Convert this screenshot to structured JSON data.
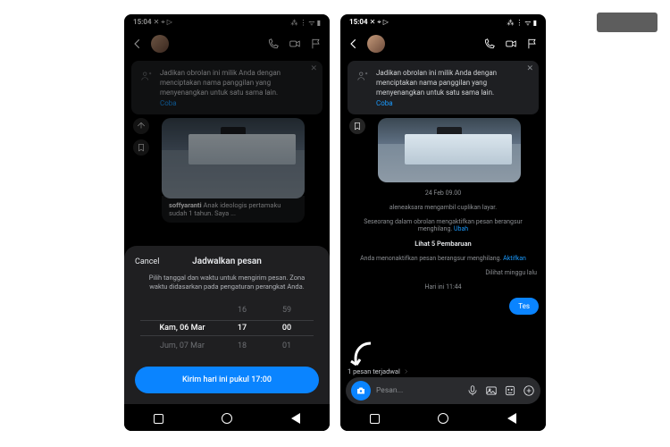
{
  "status": {
    "time": "15:04",
    "left_icons": "✕ ⌖ ▷",
    "right_icons": "⁂ ⋮ ᯤ ▮"
  },
  "header": {
    "call_icon": "call",
    "video_icon": "video",
    "flag_icon": "flag"
  },
  "suggestion": {
    "text": "Jadikan obrolan ini milik Anda dengan menciptakan nama panggilan yang menyenangkan untuk satu sama lain.",
    "try": "Coba"
  },
  "shared": {
    "user": "soffyaranti",
    "caption": "Anak ideologis pertamaku sudah 1 tahun. Saya ..."
  },
  "scheduler": {
    "cancel": "Cancel",
    "title": "Jadwalkan pesan",
    "description": "Pilih tanggal dan waktu untuk mengirim pesan. Zona waktu didasarkan pada pengaturan perangkat Anda.",
    "rows": {
      "prev": {
        "date": "",
        "hour": "16",
        "min": "59"
      },
      "sel": {
        "date": "Kam, 06 Mar",
        "hour": "17",
        "min": "00"
      },
      "next": {
        "date": "Jum, 07 Mar",
        "hour": "18",
        "min": "01"
      }
    },
    "send": "Kirim hari ini pukul 17:00"
  },
  "timeline": {
    "ts1": "24 Feb 09.00",
    "l1": "aleneaksara mengambil cuplikan layar.",
    "l2a": "Seseorang dalam obrolan mengaktifkan pesan berangsur menghilang. ",
    "l2link": "Ubah",
    "updates": "Lihat 5 Pembaruan",
    "l3a": "Anda menonaktifkan pesan berangsur menghilang. ",
    "l3link": "Aktifkan",
    "seen1": "Dilihat minggu lalu",
    "ts2": "Hari ini 11:44",
    "bubble": "Tes",
    "scheduled": "1 pesan terjadwal"
  },
  "composer": {
    "placeholder": "Pesan..."
  }
}
